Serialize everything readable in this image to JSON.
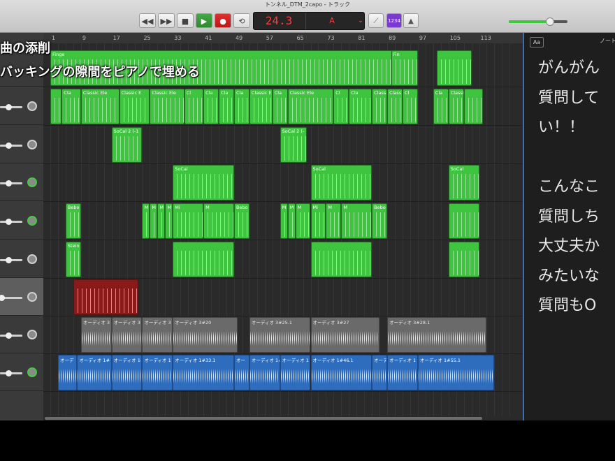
{
  "window": {
    "title": "トンネル_DTM_2capo - トラック"
  },
  "transport": {
    "rewind": "◀◀",
    "forward": "▶▶",
    "stop": "■",
    "play": "▶",
    "record": "●",
    "cycle": "⟲",
    "lcd_bar": "24.3",
    "lcd_key": "A"
  },
  "tools": {
    "count_in": "1234"
  },
  "master_volume": {
    "level": 0.7
  },
  "ruler": {
    "bars": [
      "1",
      "9",
      "17",
      "25",
      "33",
      "41",
      "49",
      "57",
      "65",
      "73",
      "81",
      "89",
      "97",
      "105",
      "113"
    ]
  },
  "overlay": {
    "line1": "曲の添削",
    "line2": "バッキングの隙間をピアノで埋める"
  },
  "notepad": {
    "tab": "Aa",
    "tab2": "ノート",
    "lines": [
      "がんがん",
      "質問して",
      "い！！",
      "",
      "こんなこ",
      "質問しち",
      "大丈夫か",
      "みたいな",
      "質問もO"
    ]
  },
  "tracks": [
    {
      "name": "track-1",
      "regions": [
        {
          "s": 1,
          "e": 97,
          "color": "green",
          "label": "Finge"
        },
        {
          "s": 97,
          "e": 97,
          "color": "green",
          "label": ""
        },
        {
          "s": 90,
          "e": 97,
          "color": "green",
          "label": "Fin"
        },
        {
          "s": 102,
          "e": 111,
          "color": "green",
          "label": ""
        }
      ]
    },
    {
      "name": "track-2",
      "regions": [
        {
          "s": 1,
          "e": 4,
          "color": "green",
          "label": ""
        },
        {
          "s": 4,
          "e": 9,
          "color": "green",
          "label": "Cla"
        },
        {
          "s": 9,
          "e": 19,
          "color": "green",
          "label": "Classic Ele"
        },
        {
          "s": 19,
          "e": 27,
          "color": "green",
          "label": "Classic E"
        },
        {
          "s": 27,
          "e": 36,
          "color": "green",
          "label": "Classic Ele"
        },
        {
          "s": 36,
          "e": 41,
          "color": "green",
          "label": "Cl"
        },
        {
          "s": 41,
          "e": 45,
          "color": "green",
          "label": "Cla"
        },
        {
          "s": 45,
          "e": 49,
          "color": "green",
          "label": "Cla"
        },
        {
          "s": 49,
          "e": 53,
          "color": "green",
          "label": "Cla"
        },
        {
          "s": 53,
          "e": 59,
          "color": "green",
          "label": "Classic E"
        },
        {
          "s": 59,
          "e": 63,
          "color": "green",
          "label": "Cla"
        },
        {
          "s": 63,
          "e": 75,
          "color": "green",
          "label": "Classic Ele"
        },
        {
          "s": 75,
          "e": 79,
          "color": "green",
          "label": "Cl"
        },
        {
          "s": 79,
          "e": 85,
          "color": "green",
          "label": "Cla"
        },
        {
          "s": 85,
          "e": 89,
          "color": "green",
          "label": "Classi"
        },
        {
          "s": 89,
          "e": 93,
          "color": "green",
          "label": "Class"
        },
        {
          "s": 93,
          "e": 97,
          "color": "green",
          "label": "Cl"
        },
        {
          "s": 101,
          "e": 105,
          "color": "green",
          "label": "Cla"
        },
        {
          "s": 105,
          "e": 109,
          "color": "green",
          "label": "Classic Ele"
        },
        {
          "s": 109,
          "e": 114,
          "color": "green",
          "label": ""
        }
      ]
    },
    {
      "name": "track-3",
      "regions": [
        {
          "s": 17,
          "e": 25,
          "color": "green",
          "label": "SoCal 2 (-1"
        },
        {
          "s": 61,
          "e": 68,
          "color": "green",
          "label": "SoCal 2 (-"
        }
      ]
    },
    {
      "name": "track-4",
      "regions": [
        {
          "s": 33,
          "e": 49,
          "color": "green",
          "label": "SoCal"
        },
        {
          "s": 69,
          "e": 85,
          "color": "green",
          "label": "SoCal"
        },
        {
          "s": 105,
          "e": 113,
          "color": "green",
          "label": "SoCal"
        }
      ]
    },
    {
      "name": "track-5",
      "regions": [
        {
          "s": 5,
          "e": 9,
          "color": "green",
          "label": "Bebo"
        },
        {
          "s": 25,
          "e": 27,
          "color": "green",
          "label": "M"
        },
        {
          "s": 27,
          "e": 29,
          "color": "green",
          "label": "M"
        },
        {
          "s": 29,
          "e": 31,
          "color": "green",
          "label": "M"
        },
        {
          "s": 31,
          "e": 33,
          "color": "green",
          "label": "M"
        },
        {
          "s": 33,
          "e": 41,
          "color": "green",
          "label": "Mi"
        },
        {
          "s": 41,
          "e": 49,
          "color": "green",
          "label": "M"
        },
        {
          "s": 49,
          "e": 53,
          "color": "green",
          "label": "Bebo"
        },
        {
          "s": 61,
          "e": 63,
          "color": "green",
          "label": "M"
        },
        {
          "s": 63,
          "e": 65,
          "color": "green",
          "label": "M"
        },
        {
          "s": 65,
          "e": 69,
          "color": "green",
          "label": "M"
        },
        {
          "s": 69,
          "e": 73,
          "color": "green",
          "label": "Mi"
        },
        {
          "s": 73,
          "e": 77,
          "color": "green",
          "label": "M"
        },
        {
          "s": 77,
          "e": 85,
          "color": "green",
          "label": "M"
        },
        {
          "s": 85,
          "e": 89,
          "color": "green",
          "label": "Bebo"
        },
        {
          "s": 105,
          "e": 113,
          "color": "green",
          "label": ""
        }
      ]
    },
    {
      "name": "track-6",
      "regions": [
        {
          "s": 5,
          "e": 9,
          "color": "green",
          "label": "Stein"
        },
        {
          "s": 33,
          "e": 49,
          "color": "green",
          "label": ""
        },
        {
          "s": 69,
          "e": 85,
          "color": "green",
          "label": ""
        },
        {
          "s": 105,
          "e": 113,
          "color": "green",
          "label": ""
        }
      ]
    },
    {
      "name": "track-7",
      "regions": [
        {
          "s": 7,
          "e": 24,
          "color": "red",
          "label": ""
        }
      ]
    },
    {
      "name": "track-8",
      "regions": [
        {
          "s": 9,
          "e": 17,
          "color": "gray",
          "label": "オーディオ 3"
        },
        {
          "s": 17,
          "e": 25,
          "color": "gray",
          "label": "オーディオ 3"
        },
        {
          "s": 25,
          "e": 33,
          "color": "gray",
          "label": "オーディオ 3"
        },
        {
          "s": 33,
          "e": 50,
          "color": "gray",
          "label": "オーディオ 3#20"
        },
        {
          "s": 53,
          "e": 69,
          "color": "gray",
          "label": "オーディオ 3#25.1"
        },
        {
          "s": 69,
          "e": 87,
          "color": "gray",
          "label": "オーディオ 3#27"
        },
        {
          "s": 89,
          "e": 115,
          "color": "gray",
          "label": "オーディオ 3#28.1"
        }
      ]
    },
    {
      "name": "track-9",
      "regions": [
        {
          "s": 3,
          "e": 8,
          "color": "blue",
          "label": "オーデ"
        },
        {
          "s": 8,
          "e": 17,
          "color": "blue",
          "label": "オーディオ 1#"
        },
        {
          "s": 17,
          "e": 25,
          "color": "blue",
          "label": "オーディオ 1#"
        },
        {
          "s": 25,
          "e": 33,
          "color": "blue",
          "label": "オーディオ 1"
        },
        {
          "s": 33,
          "e": 49,
          "color": "blue",
          "label": "オーディオ 1#33.1"
        },
        {
          "s": 49,
          "e": 53,
          "color": "blue",
          "label": "オー"
        },
        {
          "s": 53,
          "e": 61,
          "color": "blue",
          "label": "オーディオ 1#"
        },
        {
          "s": 61,
          "e": 69,
          "color": "blue",
          "label": "オーディオ 1"
        },
        {
          "s": 69,
          "e": 85,
          "color": "blue",
          "label": "オーディオ 1#46.1"
        },
        {
          "s": 85,
          "e": 89,
          "color": "blue",
          "label": "オーデ"
        },
        {
          "s": 89,
          "e": 97,
          "color": "blue",
          "label": "オーディオ 1"
        },
        {
          "s": 97,
          "e": 117,
          "color": "blue",
          "label": "オーディオ 1#55.1"
        }
      ]
    }
  ]
}
